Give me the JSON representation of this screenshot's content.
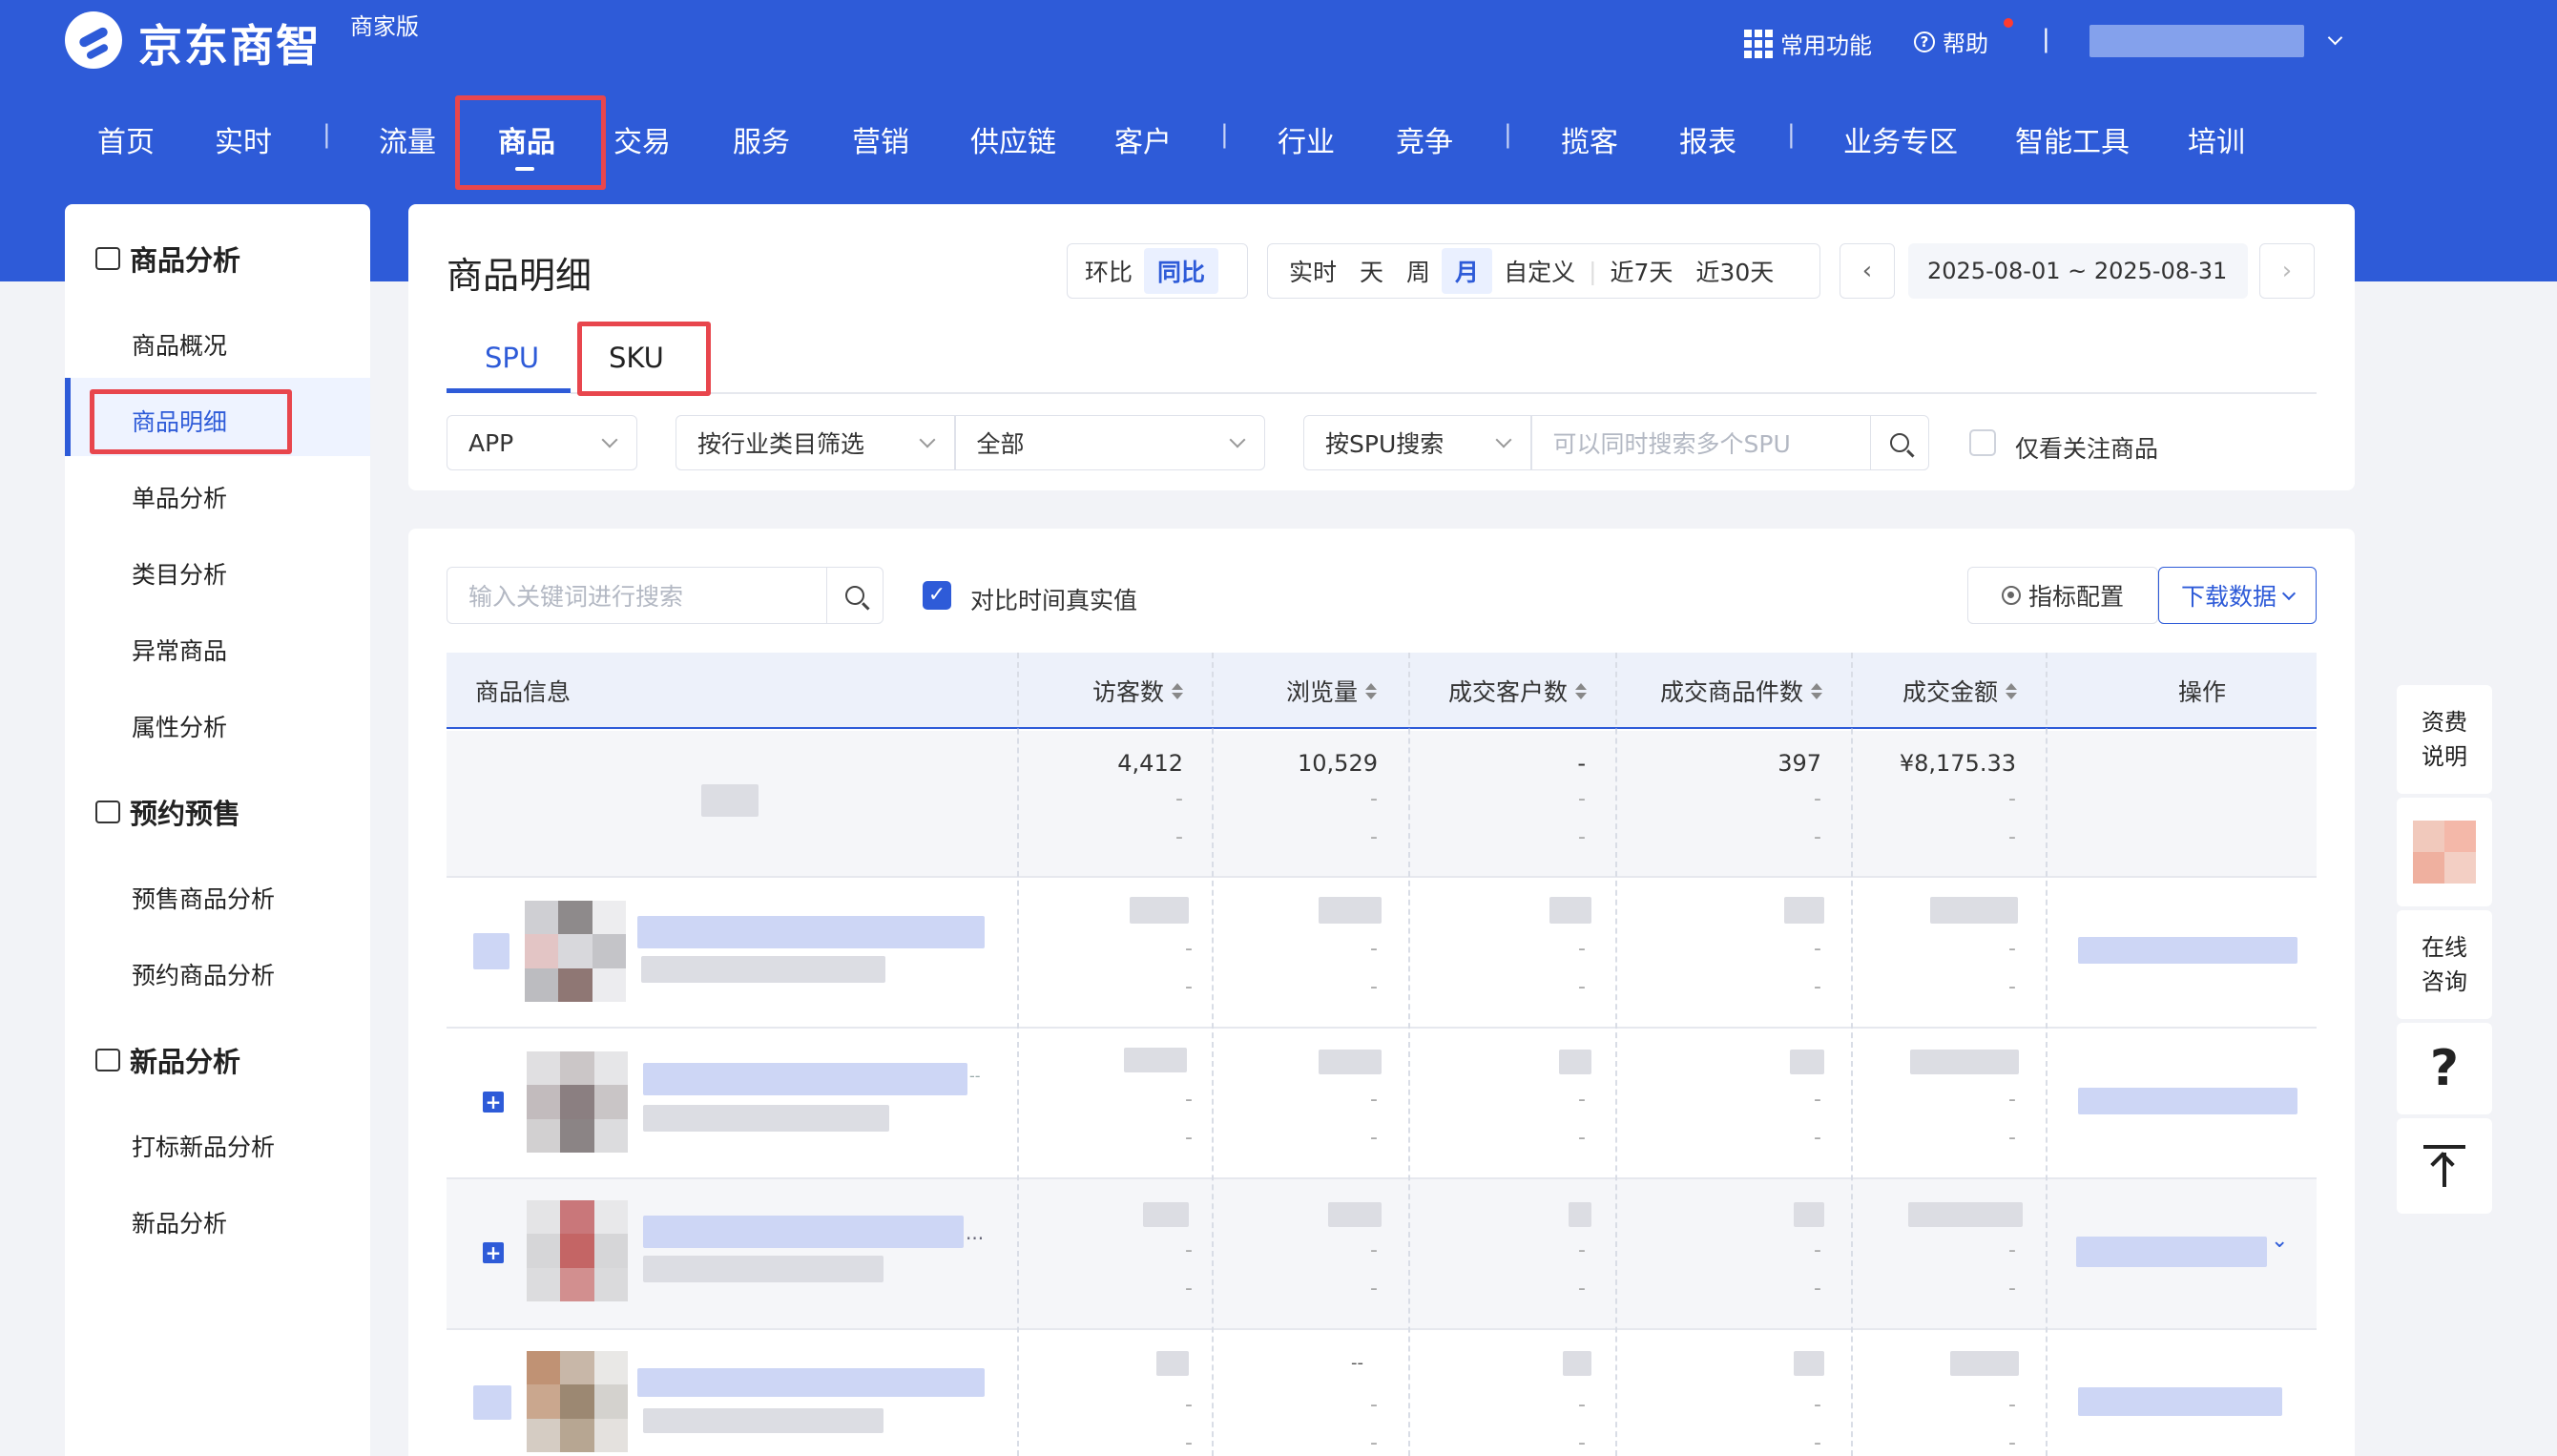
{
  "brand": {
    "name": "京东商智",
    "edition": "商家版"
  },
  "top_links": {
    "common": "常用功能",
    "help": "帮助",
    "separator": "|"
  },
  "nav": [
    "首页",
    "实时",
    "流量",
    "商品",
    "交易",
    "服务",
    "营销",
    "供应链",
    "客户",
    "行业",
    "竞争",
    "揽客",
    "报表",
    "业务专区",
    "智能工具",
    "培训"
  ],
  "nav_separator": "|",
  "sidebar": {
    "groups": [
      {
        "label": "商品分析",
        "items": [
          "商品概况",
          "商品明细",
          "单品分析",
          "类目分析",
          "异常商品",
          "属性分析"
        ]
      },
      {
        "label": "预约预售",
        "items": [
          "预售商品分析",
          "预约商品分析"
        ]
      },
      {
        "label": "新品分析",
        "items": [
          "打标新品分析",
          "新品分析"
        ]
      }
    ],
    "active_item": "商品明细"
  },
  "main": {
    "title": "商品明细",
    "compare": {
      "mom": "环比",
      "yoy": "同比"
    },
    "periods": {
      "realtime": "实时",
      "day": "天",
      "week": "周",
      "month": "月",
      "custom": "自定义",
      "last7": "近7天",
      "last30": "近30天"
    },
    "date_range": "2025-08-01 ~ 2025-08-31",
    "prev_icon": "‹",
    "next_icon": "›",
    "tabs": [
      "SPU",
      "SKU"
    ],
    "filters": {
      "platform": "APP",
      "category_filter": "按行业类目筛选",
      "category_value": "全部",
      "search_type": "按SPU搜索",
      "search_placeholder": "可以同时搜索多个SPU",
      "follow_only": "仅看关注商品"
    }
  },
  "table_panel": {
    "keyword_placeholder": "输入关键词进行搜索",
    "compare_real": "对比时间真实值",
    "compare_checkbox": "✓",
    "metric_config": "指标配置",
    "download": "下载数据",
    "columns": [
      "商品信息",
      "访客数",
      "浏览量",
      "成交客户数",
      "成交商品件数",
      "成交金额",
      "操作"
    ],
    "summary": {
      "visitors": "4,412",
      "views": "10,529",
      "customers": "-",
      "units": "397",
      "amount": "¥8,175.33"
    },
    "dash": "-",
    "plus_icon": "+",
    "ellipsis": "...",
    "dots": "--",
    "chevron": "⌄"
  },
  "float": {
    "fee": "资费\n说明",
    "consult": "在线\n咨询",
    "question": "?",
    "top": "↑"
  },
  "colors": {
    "brand_blue": "#2e5bd8",
    "highlight_red": "#e8464d"
  }
}
